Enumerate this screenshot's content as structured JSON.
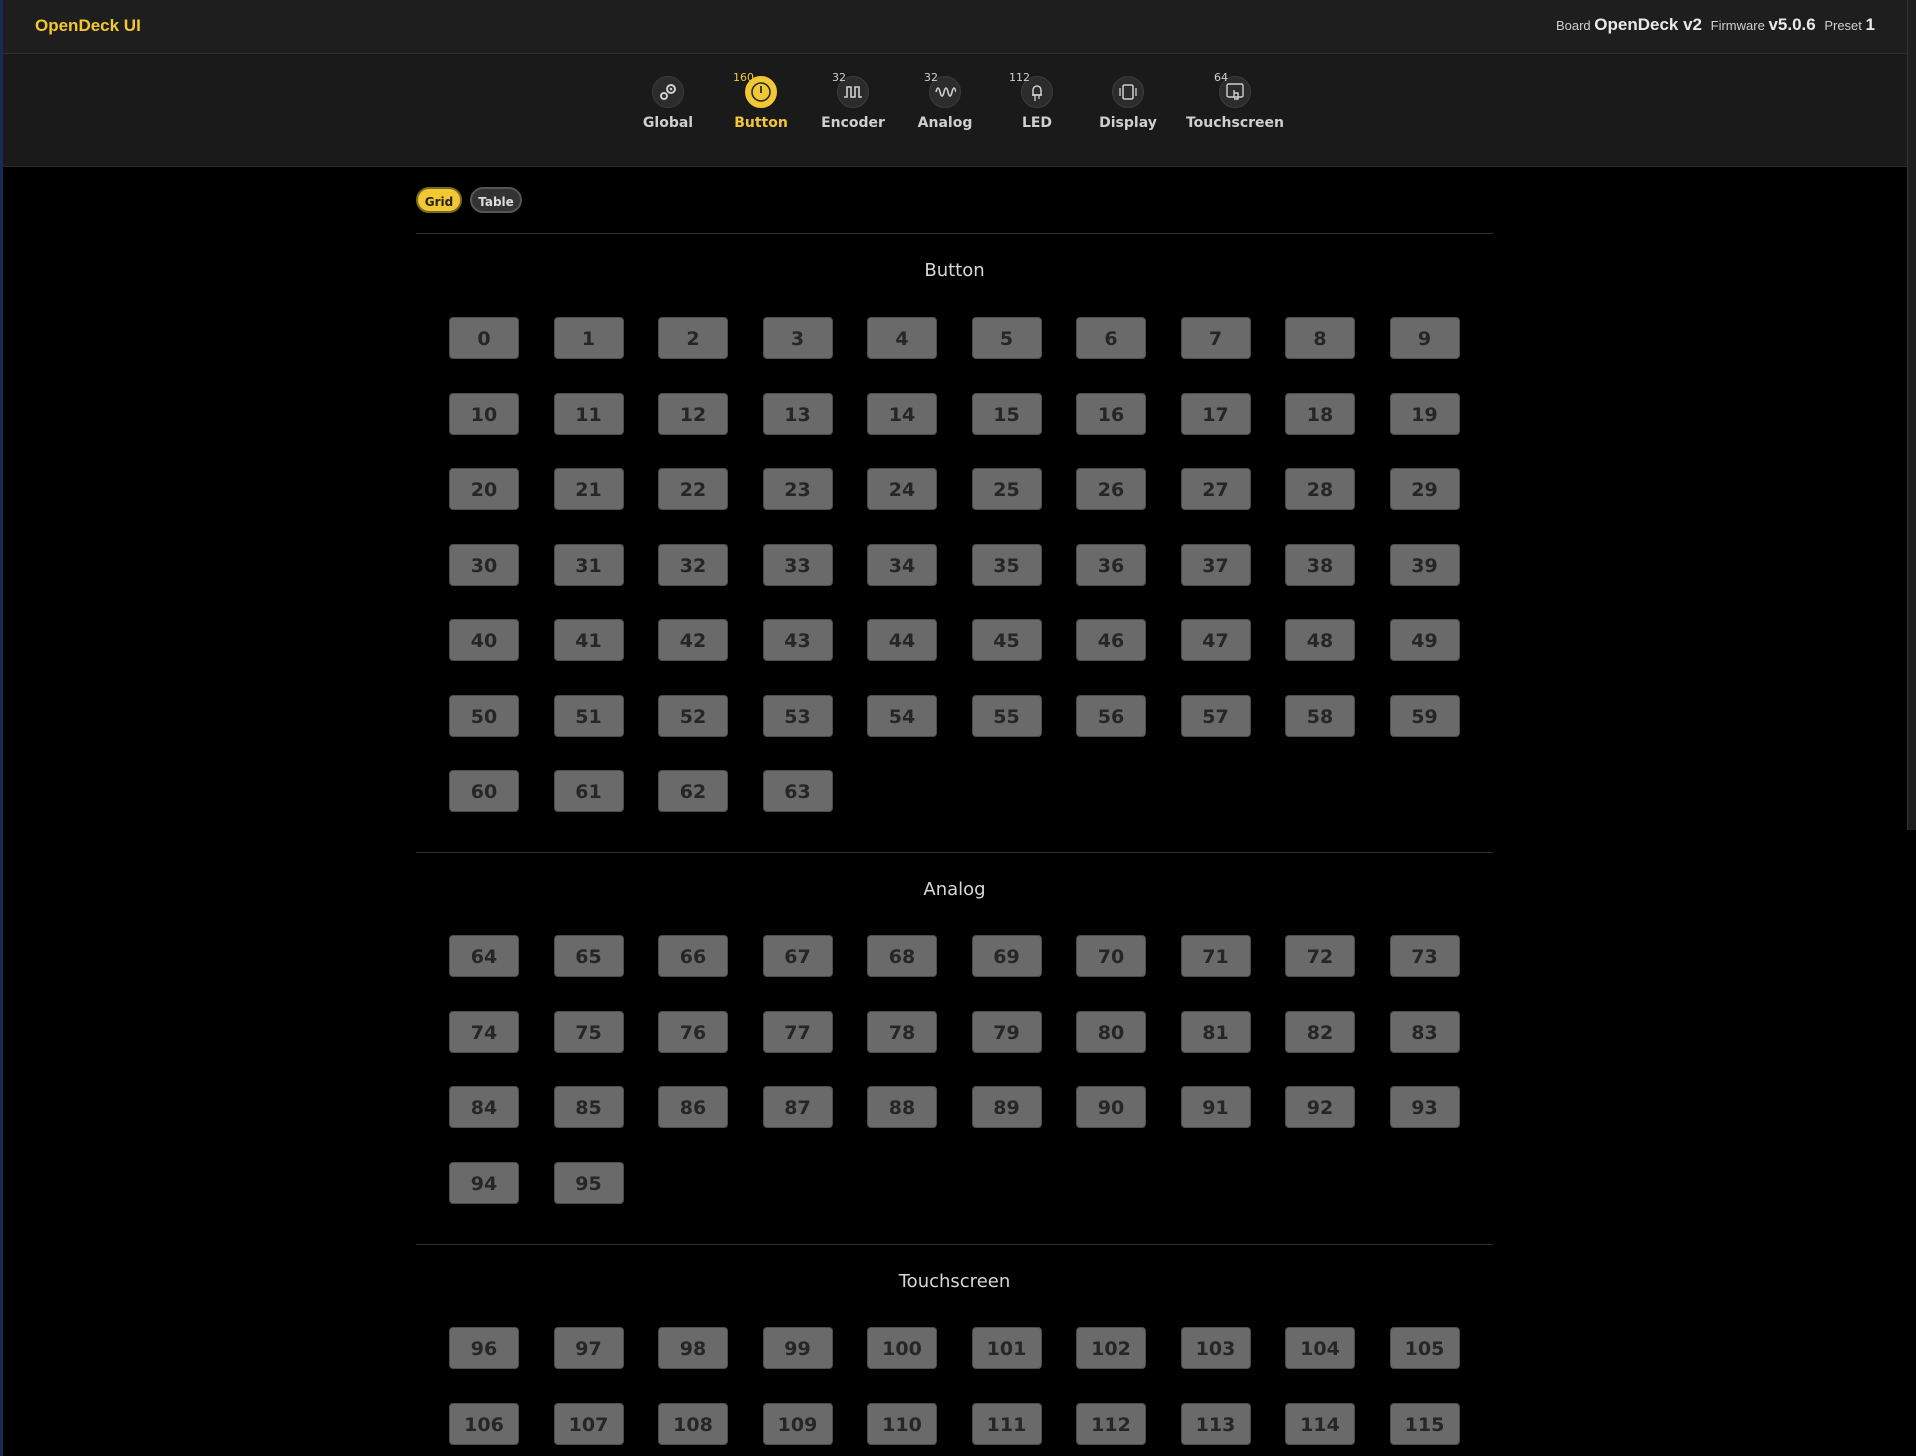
{
  "header": {
    "app_title": "OpenDeck UI",
    "board_label": "Board",
    "board_value": "OpenDeck v2",
    "firmware_label": "Firmware",
    "firmware_value": "v5.0.6",
    "preset_label": "Preset",
    "preset_value": "1"
  },
  "nav": {
    "items": [
      {
        "label": "Global",
        "count": "",
        "icon": "gears-icon",
        "active": false
      },
      {
        "label": "Button",
        "count": "160",
        "icon": "power-button-icon",
        "active": true
      },
      {
        "label": "Encoder",
        "count": "32",
        "icon": "square-wave-icon",
        "active": false
      },
      {
        "label": "Analog",
        "count": "32",
        "icon": "sine-wave-icon",
        "active": false
      },
      {
        "label": "LED",
        "count": "112",
        "icon": "led-icon",
        "active": false
      },
      {
        "label": "Display",
        "count": "",
        "icon": "display-icon",
        "active": false
      },
      {
        "label": "Touchscreen",
        "count": "64",
        "icon": "touchscreen-icon",
        "active": false
      }
    ]
  },
  "view_toggle": {
    "grid": "Grid",
    "table": "Table",
    "selected": "Grid"
  },
  "sections": [
    {
      "title": "Button",
      "items": [
        "0",
        "1",
        "2",
        "3",
        "4",
        "5",
        "6",
        "7",
        "8",
        "9",
        "10",
        "11",
        "12",
        "13",
        "14",
        "15",
        "16",
        "17",
        "18",
        "19",
        "20",
        "21",
        "22",
        "23",
        "24",
        "25",
        "26",
        "27",
        "28",
        "29",
        "30",
        "31",
        "32",
        "33",
        "34",
        "35",
        "36",
        "37",
        "38",
        "39",
        "40",
        "41",
        "42",
        "43",
        "44",
        "45",
        "46",
        "47",
        "48",
        "49",
        "50",
        "51",
        "52",
        "53",
        "54",
        "55",
        "56",
        "57",
        "58",
        "59",
        "60",
        "61",
        "62",
        "63"
      ]
    },
    {
      "title": "Analog",
      "items": [
        "64",
        "65",
        "66",
        "67",
        "68",
        "69",
        "70",
        "71",
        "72",
        "73",
        "74",
        "75",
        "76",
        "77",
        "78",
        "79",
        "80",
        "81",
        "82",
        "83",
        "84",
        "85",
        "86",
        "87",
        "88",
        "89",
        "90",
        "91",
        "92",
        "93",
        "94",
        "95"
      ]
    },
    {
      "title": "Touchscreen",
      "items": [
        "96",
        "97",
        "98",
        "99",
        "100",
        "101",
        "102",
        "103",
        "104",
        "105",
        "106",
        "107",
        "108",
        "109",
        "110",
        "111",
        "112",
        "113",
        "114",
        "115"
      ]
    }
  ],
  "colors": {
    "accent": "#f2c734",
    "tile": "#6a6a6a",
    "background": "#000000"
  }
}
